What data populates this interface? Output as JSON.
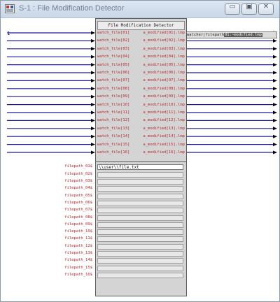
{
  "window": {
    "title": "S-1 : File Modification Detector",
    "buttons": {
      "minimize": "▭",
      "maximize": "▣",
      "close": "✕"
    }
  },
  "block": {
    "title": "File Modification Detector",
    "inputs": [
      "watch_file[01]",
      "watch_file[02]",
      "watch_file[03]",
      "watch_file[04]",
      "watch_file[05]",
      "watch_file[06]",
      "watch_file[07]",
      "watch_file[08]",
      "watch_file[09]",
      "watch_file[10]",
      "watch_file[11]",
      "watch_file[12]",
      "watch_file[13]",
      "watch_file[14]",
      "watch_file[15]",
      "watch_file[16]"
    ],
    "outputs": [
      "a_modified[01].lmp",
      "a_modified[02].lmp",
      "a_modified[03].lmp",
      "a_modified[04].lmp",
      "a_modified[05].lmp",
      "a_modified[06].lmp",
      "a_modified[07].lmp",
      "a_modified[08].lmp",
      "a_modified[09].lmp",
      "a_modified[10].lmp",
      "a_modified[11].lmp",
      "a_modified[12].lmp",
      "a_modified[13].lmp",
      "a_modified[14].lmp",
      "a_modified[15].lmp",
      "a_modified[16].lmp"
    ],
    "params": [
      {
        "label": "filepath_01$",
        "value": "\\\\user\\\\file.txt"
      },
      {
        "label": "filepath_02$",
        "value": ""
      },
      {
        "label": "filepath_03$",
        "value": ""
      },
      {
        "label": "filepath_04$",
        "value": ""
      },
      {
        "label": "filepath_05$",
        "value": ""
      },
      {
        "label": "filepath_06$",
        "value": ""
      },
      {
        "label": "filepath_07$",
        "value": ""
      },
      {
        "label": "filepath_08$",
        "value": ""
      },
      {
        "label": "filepath_09$",
        "value": ""
      },
      {
        "label": "filepath_10$",
        "value": ""
      },
      {
        "label": "filepath_11$",
        "value": ""
      },
      {
        "label": "filepath_12$",
        "value": ""
      },
      {
        "label": "filepath_13$",
        "value": ""
      },
      {
        "label": "filepath_14$",
        "value": ""
      },
      {
        "label": "filepath_15$",
        "value": ""
      },
      {
        "label": "filepath_16$",
        "value": ""
      }
    ]
  },
  "input_signal_label": "1",
  "output_display": {
    "prefix": "watcher|filepath",
    "highlight": "01:~modified.lmp"
  },
  "colors": {
    "wire": "#1a1aa0",
    "port_text": "#b4282d",
    "block_bg": "#d4d4d4"
  }
}
